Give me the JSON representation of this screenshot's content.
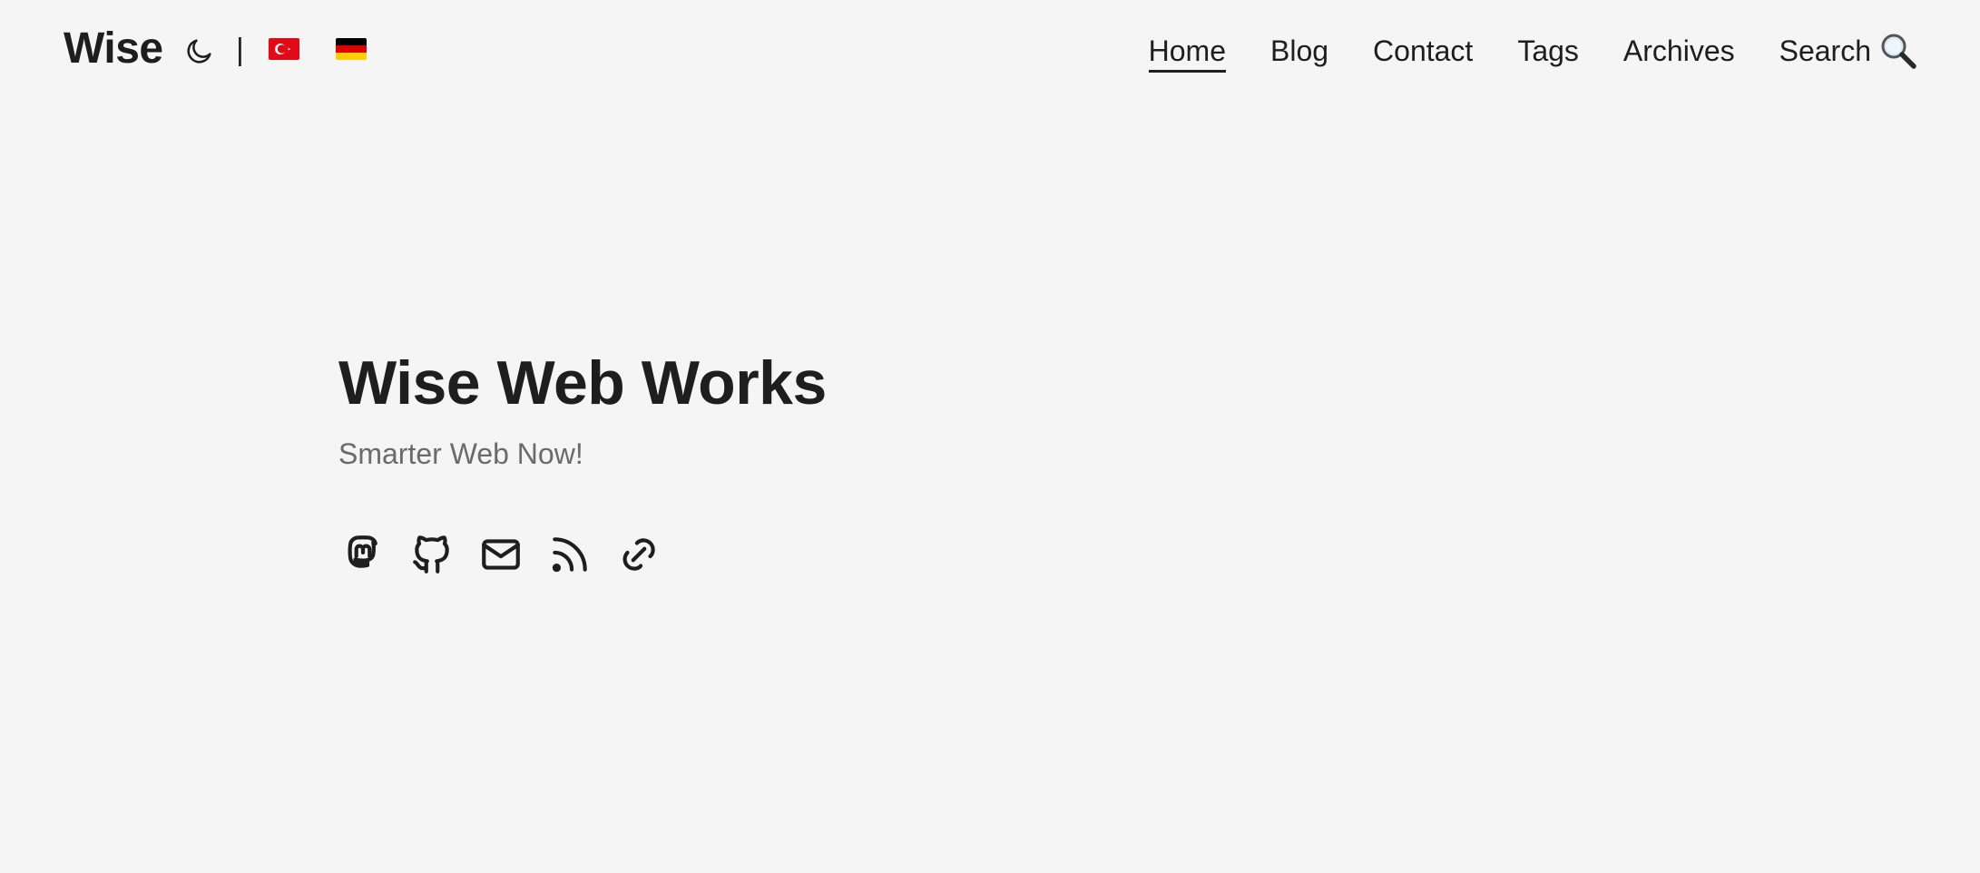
{
  "header": {
    "logo": "Wise",
    "divider": "|",
    "theme_toggle_icon": "moon-icon",
    "languages": [
      {
        "name": "Turkish",
        "icon": "turkey-flag-icon"
      },
      {
        "name": "German",
        "icon": "germany-flag-icon"
      }
    ],
    "nav": {
      "home": "Home",
      "blog": "Blog",
      "contact": "Contact",
      "tags": "Tags",
      "archives": "Archives",
      "search": "Search"
    },
    "active_nav": "Home"
  },
  "hero": {
    "title": "Wise Web Works",
    "subtitle": "Smarter Web Now!"
  },
  "social_icons": [
    "mastodon-icon",
    "github-icon",
    "email-icon",
    "rss-icon",
    "link-icon"
  ],
  "colors": {
    "background": "#f5f5f5",
    "text": "#1e1e1e",
    "subtitle": "#6b6b6b",
    "flag_red": "#e30a17",
    "flag_black": "#000000",
    "flag_gold": "#ffce00"
  }
}
